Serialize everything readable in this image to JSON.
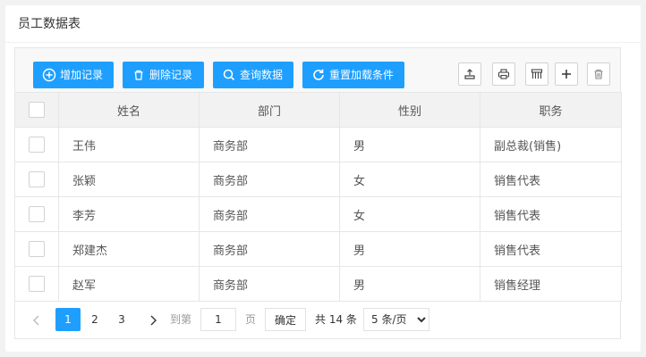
{
  "panel": {
    "title": "员工数据表"
  },
  "toolbar": {
    "add_label": "增加记录",
    "delete_label": "删除记录",
    "query_label": "查询数据",
    "reset_label": "重置加载条件"
  },
  "table": {
    "columns": [
      "姓名",
      "部门",
      "性别",
      "职务"
    ],
    "rows": [
      [
        "王伟",
        "商务部",
        "男",
        "副总裁(销售)"
      ],
      [
        "张颖",
        "商务部",
        "女",
        "销售代表"
      ],
      [
        "李芳",
        "商务部",
        "女",
        "销售代表"
      ],
      [
        "郑建杰",
        "商务部",
        "男",
        "销售代表"
      ],
      [
        "赵军",
        "商务部",
        "男",
        "销售经理"
      ]
    ]
  },
  "pager": {
    "pages": [
      "1",
      "2",
      "3"
    ],
    "goto_label": "到第",
    "page_input_value": "1",
    "page_unit": "页",
    "confirm_label": "确定",
    "total_label": "共 14 条",
    "page_size_selected": "5 条/页",
    "accent_color": "#1e9fff"
  }
}
